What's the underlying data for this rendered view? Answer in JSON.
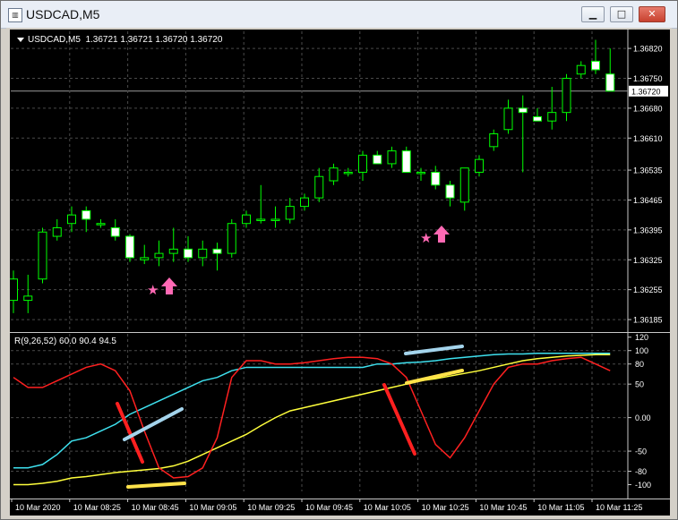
{
  "window": {
    "title": "USDCAD,M5",
    "icon": "chart-window-icon",
    "buttons": {
      "minimize": "▁",
      "maximize": "□",
      "close": "✕"
    }
  },
  "chart": {
    "header": {
      "symbol": "USDCAD,M5",
      "ohlc": "1.36721 1.36721 1.36720 1.36720"
    },
    "indicator_label": "R(9,26,52) 60.0 90.4 94.5",
    "colors": {
      "background": "#000000",
      "bull": "#00ff00",
      "bear_body": "#ffffff",
      "grid": "#4a4a4a",
      "cyan": "#3ee0ee",
      "yellow": "#ffff3c",
      "red": "#ff2020",
      "pink": "#ff69b4",
      "lightblue": "#a4d4ec",
      "thick_yellow": "#ffe24a"
    },
    "price_axis": [
      "1.36820",
      "1.36750",
      "1.36680",
      "1.36610",
      "1.36535",
      "1.36465",
      "1.36395",
      "1.36325",
      "1.36255",
      "1.36185"
    ],
    "current_price": "1.36720",
    "indicator_axis": [
      "120",
      "100",
      "80",
      "50",
      "0.00",
      "-50",
      "-80",
      "-100"
    ],
    "time_axis": [
      "10 Mar 2020",
      "10 Mar 08:25",
      "10 Mar 08:45",
      "10 Mar 09:05",
      "10 Mar 09:25",
      "10 Mar 09:45",
      "10 Mar 10:05",
      "10 Mar 10:25",
      "10 Mar 10:45",
      "10 Mar 11:05",
      "10 Mar 11:25"
    ]
  },
  "chart_data": {
    "type": "candlestick",
    "candles": [
      {
        "o": 1.3623,
        "h": 1.363,
        "l": 1.362,
        "c": 1.3628
      },
      {
        "o": 1.3623,
        "h": 1.3629,
        "l": 1.362,
        "c": 1.3624
      },
      {
        "o": 1.3628,
        "h": 1.364,
        "l": 1.3627,
        "c": 1.3639
      },
      {
        "o": 1.3638,
        "h": 1.3642,
        "l": 1.3637,
        "c": 1.364
      },
      {
        "o": 1.3641,
        "h": 1.3645,
        "l": 1.3639,
        "c": 1.3643
      },
      {
        "o": 1.3644,
        "h": 1.3645,
        "l": 1.3639,
        "c": 1.3642
      },
      {
        "o": 1.3641,
        "h": 1.3642,
        "l": 1.364,
        "c": 1.3641
      },
      {
        "o": 1.364,
        "h": 1.3642,
        "l": 1.3637,
        "c": 1.3638
      },
      {
        "o": 1.3638,
        "h": 1.36385,
        "l": 1.3632,
        "c": 1.3633
      },
      {
        "o": 1.36325,
        "h": 1.3636,
        "l": 1.36315,
        "c": 1.3633
      },
      {
        "o": 1.3633,
        "h": 1.3637,
        "l": 1.3631,
        "c": 1.3634
      },
      {
        "o": 1.3634,
        "h": 1.364,
        "l": 1.3632,
        "c": 1.3635
      },
      {
        "o": 1.3635,
        "h": 1.3638,
        "l": 1.3632,
        "c": 1.3633
      },
      {
        "o": 1.3633,
        "h": 1.3637,
        "l": 1.3631,
        "c": 1.3635
      },
      {
        "o": 1.3635,
        "h": 1.36365,
        "l": 1.363,
        "c": 1.3634
      },
      {
        "o": 1.3634,
        "h": 1.3642,
        "l": 1.3633,
        "c": 1.3641
      },
      {
        "o": 1.3641,
        "h": 1.3644,
        "l": 1.364,
        "c": 1.3643
      },
      {
        "o": 1.3642,
        "h": 1.365,
        "l": 1.3641,
        "c": 1.3642
      },
      {
        "o": 1.3642,
        "h": 1.3645,
        "l": 1.364,
        "c": 1.3642
      },
      {
        "o": 1.3642,
        "h": 1.3647,
        "l": 1.3641,
        "c": 1.3645
      },
      {
        "o": 1.3645,
        "h": 1.3648,
        "l": 1.3644,
        "c": 1.3647
      },
      {
        "o": 1.3647,
        "h": 1.3654,
        "l": 1.3646,
        "c": 1.3652
      },
      {
        "o": 1.3651,
        "h": 1.3655,
        "l": 1.365,
        "c": 1.3654
      },
      {
        "o": 1.3653,
        "h": 1.3654,
        "l": 1.3652,
        "c": 1.3653
      },
      {
        "o": 1.3653,
        "h": 1.3658,
        "l": 1.3651,
        "c": 1.3657
      },
      {
        "o": 1.3657,
        "h": 1.3658,
        "l": 1.3655,
        "c": 1.3655
      },
      {
        "o": 1.3655,
        "h": 1.3659,
        "l": 1.3654,
        "c": 1.3658
      },
      {
        "o": 1.3658,
        "h": 1.3659,
        "l": 1.3653,
        "c": 1.3653
      },
      {
        "o": 1.3653,
        "h": 1.3654,
        "l": 1.3651,
        "c": 1.3653
      },
      {
        "o": 1.3653,
        "h": 1.36545,
        "l": 1.3649,
        "c": 1.365
      },
      {
        "o": 1.365,
        "h": 1.3651,
        "l": 1.3645,
        "c": 1.3647
      },
      {
        "o": 1.3646,
        "h": 1.3654,
        "l": 1.3644,
        "c": 1.3654
      },
      {
        "o": 1.3653,
        "h": 1.3657,
        "l": 1.3652,
        "c": 1.3656
      },
      {
        "o": 1.3659,
        "h": 1.3663,
        "l": 1.3658,
        "c": 1.3662
      },
      {
        "o": 1.3663,
        "h": 1.367,
        "l": 1.3662,
        "c": 1.3668
      },
      {
        "o": 1.3668,
        "h": 1.3671,
        "l": 1.3653,
        "c": 1.3667
      },
      {
        "o": 1.3666,
        "h": 1.3668,
        "l": 1.3665,
        "c": 1.3665
      },
      {
        "o": 1.3665,
        "h": 1.3673,
        "l": 1.3663,
        "c": 1.3667
      },
      {
        "o": 1.3667,
        "h": 1.3676,
        "l": 1.3665,
        "c": 1.3675
      },
      {
        "o": 1.3676,
        "h": 1.3679,
        "l": 1.3675,
        "c": 1.3678
      },
      {
        "o": 1.3679,
        "h": 1.3684,
        "l": 1.3676,
        "c": 1.3677
      },
      {
        "o": 1.3676,
        "h": 1.3682,
        "l": 1.3672,
        "c": 1.3672
      }
    ],
    "indicator_series": [
      {
        "color": "cyan",
        "values": [
          -75,
          -75,
          -70,
          -55,
          -35,
          -30,
          -20,
          -10,
          5,
          15,
          25,
          35,
          45,
          55,
          60,
          70,
          75,
          75,
          75,
          75,
          75,
          75,
          75,
          75,
          75,
          80,
          80,
          82,
          83,
          85,
          88,
          90,
          92,
          94,
          95,
          95,
          96,
          96,
          96,
          96,
          96,
          96
        ]
      },
      {
        "color": "yellow",
        "values": [
          -100,
          -100,
          -98,
          -95,
          -90,
          -88,
          -85,
          -82,
          -80,
          -78,
          -76,
          -72,
          -65,
          -55,
          -45,
          -35,
          -25,
          -12,
          0,
          10,
          15,
          20,
          25,
          30,
          35,
          40,
          45,
          50,
          55,
          58,
          62,
          66,
          70,
          75,
          80,
          85,
          88,
          90,
          92,
          93,
          94,
          94
        ]
      },
      {
        "color": "red",
        "values": [
          60,
          45,
          45,
          55,
          65,
          75,
          80,
          70,
          40,
          -20,
          -75,
          -90,
          -88,
          -75,
          -30,
          60,
          85,
          85,
          80,
          80,
          82,
          85,
          88,
          90,
          90,
          88,
          80,
          60,
          10,
          -40,
          -60,
          -30,
          10,
          50,
          75,
          80,
          80,
          85,
          88,
          90,
          80,
          70
        ]
      }
    ]
  }
}
